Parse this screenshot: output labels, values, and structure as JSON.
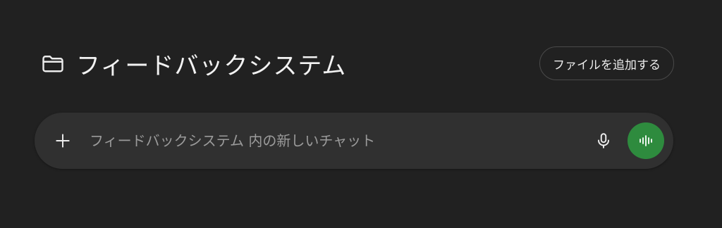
{
  "project": {
    "title": "フィードバックシステム",
    "icon": "folder-icon",
    "add_files_label": "ファイルを追加する"
  },
  "composer": {
    "placeholder": "フィードバックシステム 内の新しいチャット",
    "value": "",
    "plus_icon": "plus-icon",
    "mic_icon": "microphone-icon",
    "voice_icon": "voice-waveform-icon"
  },
  "colors": {
    "background": "#212121",
    "composer_background": "#303030",
    "voice_button": "#2e8b3e",
    "text": "#ececec",
    "placeholder": "#9b9b9b"
  }
}
